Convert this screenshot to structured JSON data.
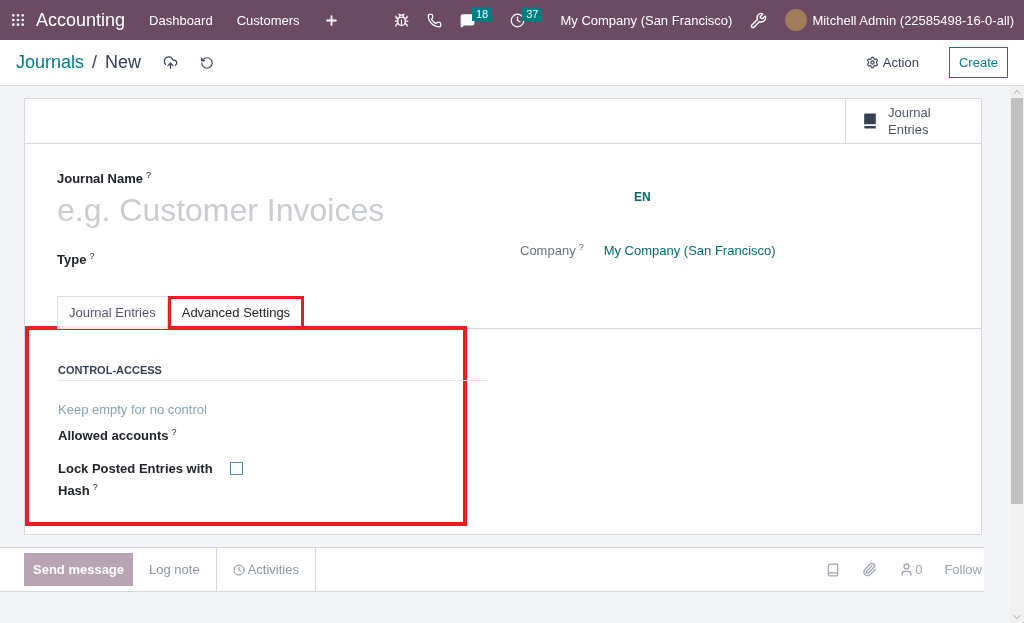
{
  "navbar": {
    "app": "Accounting",
    "menu": [
      {
        "label": "Dashboard"
      },
      {
        "label": "Customers"
      }
    ],
    "messages_badge": "18",
    "activities_badge": "37",
    "company": "My Company (San Francisco)",
    "user": "Mitchell Admin (22585498-16-0-all)"
  },
  "breadcrumb": {
    "parent": "Journals",
    "separator": "/",
    "current": "New"
  },
  "actions": {
    "action": "Action",
    "create": "Create"
  },
  "smart_button": {
    "label": "Journal Entries"
  },
  "form": {
    "name_label": "Journal Name",
    "name_help": "?",
    "name_placeholder": "e.g. Customer Invoices",
    "lang": "EN",
    "type_label": "Type",
    "type_help": "?",
    "company_label": "Company",
    "company_help": "?",
    "company_value": "My Company (San Francisco)"
  },
  "tabs": [
    {
      "label": "Journal Entries",
      "selected": false,
      "highlighted": false
    },
    {
      "label": "Advanced Settings",
      "selected": true,
      "highlighted": true
    }
  ],
  "section": {
    "title": "CONTROL-ACCESS",
    "highlighted": true,
    "hint": "Keep empty for no control",
    "fields": [
      {
        "kind": "many2many",
        "label": "Allowed accounts",
        "help": "?"
      },
      {
        "kind": "checkbox",
        "label": "Lock Posted Entries with Hash",
        "help": "?",
        "checked": false
      }
    ]
  },
  "chatter": {
    "send": "Send message",
    "log": "Log note",
    "activities": "Activities",
    "followers": "0",
    "follow": "Follow"
  }
}
